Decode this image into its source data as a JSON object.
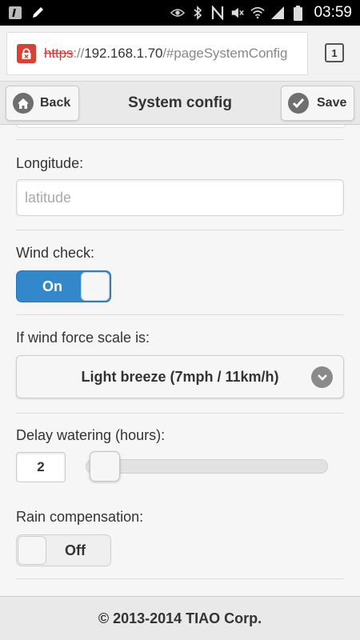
{
  "status_bar": {
    "time": "03:59",
    "left_icons": [
      "info-icon",
      "pencil-icon"
    ],
    "right_icons": [
      "eye-icon",
      "bluetooth-icon",
      "nfc-icon",
      "mute-icon",
      "wifi-icon",
      "signal-icon",
      "battery-icon"
    ]
  },
  "browser": {
    "url_scheme": "https",
    "url_sep": "://",
    "url_host": "192.168.1.70",
    "url_path": "/#pageSystemConfig",
    "tab_count": "1"
  },
  "header": {
    "back_label": "Back",
    "title": "System config",
    "save_label": "Save"
  },
  "form": {
    "longitude": {
      "label": "Longitude:",
      "value": "",
      "placeholder": "latitude"
    },
    "wind_check": {
      "label": "Wind check:",
      "state": "On"
    },
    "wind_force": {
      "label": "If wind force scale is:",
      "selected": "Light breeze (7mph / 11km/h)"
    },
    "delay_watering": {
      "label": "Delay watering (hours):",
      "value": "2"
    },
    "rain_compensation": {
      "label": "Rain compensation:",
      "state": "Off"
    }
  },
  "footer": {
    "text": "© 2013-2014 TIAO Corp."
  },
  "colors": {
    "toggle_on": "#3388cc",
    "lock_red": "#d84235",
    "scheme_red": "#dd3333"
  }
}
